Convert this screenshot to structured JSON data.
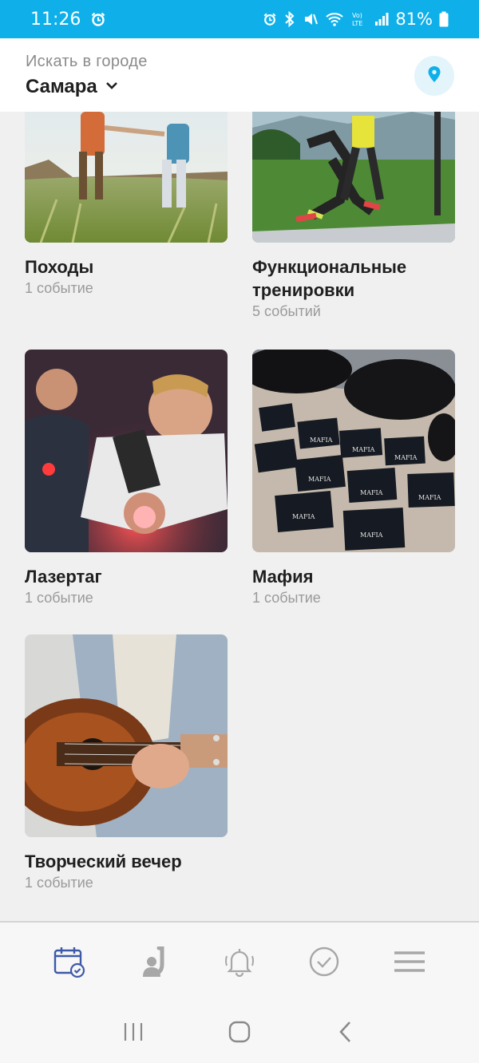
{
  "status_bar": {
    "time": "11:26",
    "battery": "81%"
  },
  "header": {
    "search_label": "Искать в городе",
    "city": "Самара"
  },
  "categories": [
    {
      "title": "Походы",
      "count": "1 событие"
    },
    {
      "title": "Функциональные тренировки",
      "count": "5 событий"
    },
    {
      "title": "Лазертаг",
      "count": "1 событие"
    },
    {
      "title": "Мафия",
      "count": "1 событие"
    },
    {
      "title": "Творческий вечер",
      "count": "1 событие"
    }
  ],
  "bottom_nav": {
    "items": [
      "calendar-icon",
      "person-icon",
      "bell-icon",
      "check-circle-icon",
      "menu-icon"
    ],
    "active_color": "#3d5aa8",
    "inactive_color": "#a7a7a7"
  },
  "colors": {
    "status_bar": "#0fb0ea",
    "accent": "#0fb0ea"
  }
}
